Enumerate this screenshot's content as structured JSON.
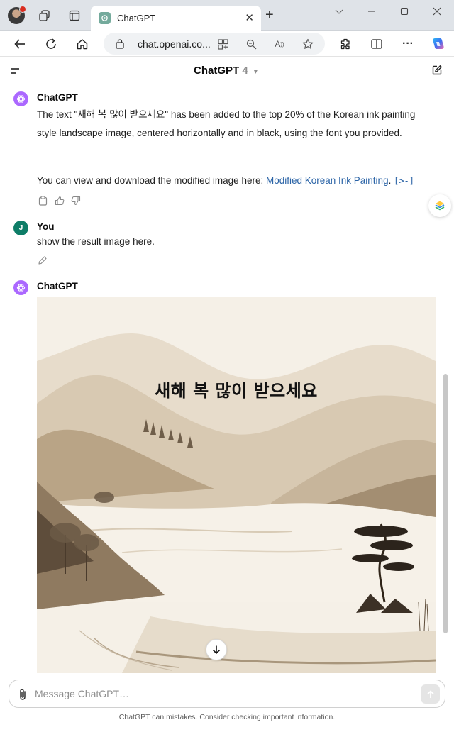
{
  "browser": {
    "tab": {
      "title": "ChatGPT"
    },
    "address": {
      "url": "chat.openai.co..."
    },
    "icons": [
      "profile-avatar",
      "workspaces-icon",
      "tab-actions-icon",
      "close-icon",
      "plus-icon",
      "minimize-icon",
      "maximize-icon",
      "window-close-icon",
      "back-arrow-icon",
      "refresh-icon",
      "home-icon",
      "lock-icon",
      "app-available-icon",
      "zoom-icon",
      "read-aloud-icon",
      "favorite-star-icon",
      "extensions-icon",
      "split-screen-icon",
      "more-icon",
      "copilot-icon"
    ]
  },
  "app": {
    "model": {
      "name": "ChatGPT",
      "version": "4"
    },
    "messages": [
      {
        "author": "ChatGPT",
        "text": "The text \"새해 복 많이 받으세요\" has been added to the top 20% of the Korean ink painting style landscape image, centered horizontally and in black, using the font you provided.",
        "text2_prefix": "You can view and download the modified image here: ",
        "link_text": "Modified Korean Ink Painting",
        "text2_suffix": ".",
        "citation": "[>-]"
      },
      {
        "author": "You",
        "avatar_letter": "J",
        "text": "show the result image here."
      },
      {
        "author": "ChatGPT",
        "image_caption": "새해 복 많이 받으세요"
      }
    ],
    "composer": {
      "placeholder": "Message ChatGPT…"
    },
    "disclaimer": "ChatGPT can mistakes. Consider checking important information."
  },
  "colors": {
    "accent_user": "#0e7d67",
    "accent_gpt": "#ab68ff",
    "link": "#2a63a6",
    "painting_sepia": "#7a6a58",
    "paper": "#f4efe6"
  }
}
